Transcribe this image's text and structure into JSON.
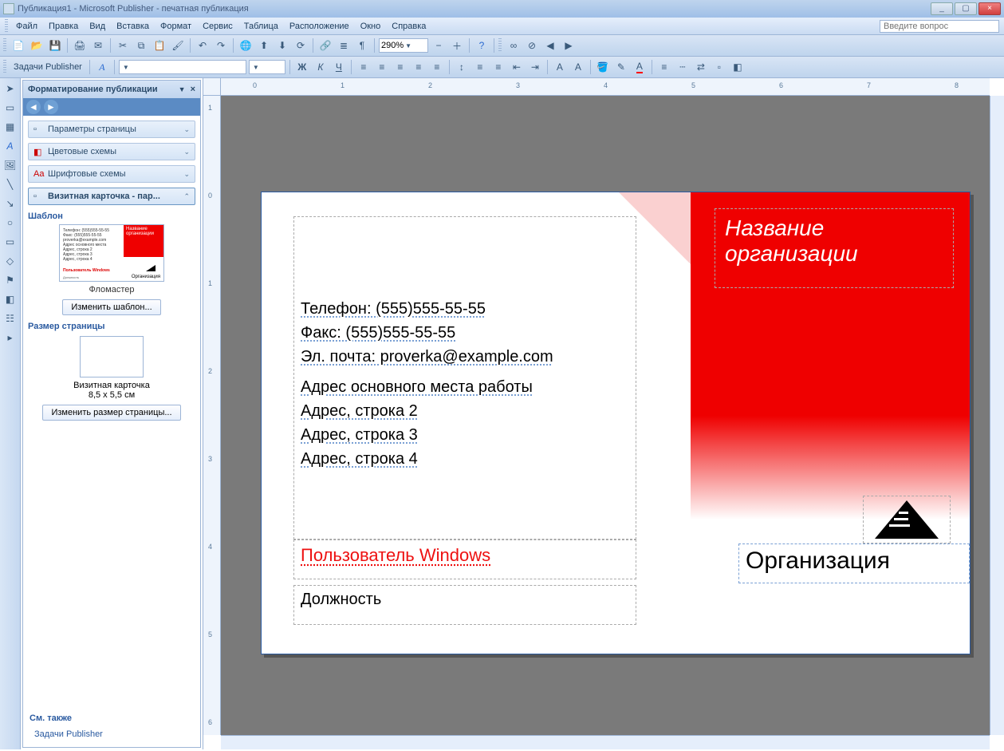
{
  "title": "Публикация1 - Microsoft Publisher - печатная публикация",
  "menu": {
    "file": "Файл",
    "edit": "Правка",
    "view": "Вид",
    "insert": "Вставка",
    "format": "Формат",
    "tools": "Сервис",
    "table": "Таблица",
    "arrange": "Расположение",
    "window": "Окно",
    "help": "Справка"
  },
  "askbox_placeholder": "Введите вопрос",
  "toolbar2_label": "Задачи Publisher",
  "zoom_value": "290%",
  "taskpane": {
    "title": "Форматирование публикации",
    "section_page": "Параметры страницы",
    "section_color": "Цветовые схемы",
    "section_font": "Шрифтовые схемы",
    "section_card": "Визитная карточка - пар...",
    "template_label": "Шаблон",
    "template_name": "Фломастер",
    "change_template_btn": "Изменить шаблон...",
    "size_label": "Размер страницы",
    "size_name": "Визитная карточка",
    "size_dims": "8,5 x 5,5 см",
    "change_size_btn": "Изменить размер страницы...",
    "see_also": "См. также",
    "tasks_link": "Задачи Publisher"
  },
  "card": {
    "orgname": "Название организации",
    "phone": "Телефон: (555)555-55-55",
    "fax": "Факс: (555)555-55-55",
    "email": "Эл. почта: proverka@example.com",
    "addr0": "Адрес основного места работы",
    "addr1": "Адрес, строка 2",
    "addr2": "Адрес, строка 3",
    "addr3": "Адрес, строка 4",
    "username": "Пользователь Windows",
    "role": "Должность",
    "orgcaption": "Организация"
  },
  "thumb": {
    "mini_orgname": "Название организации",
    "mini_org": "Организация",
    "mini_user": "Пользователь Windows"
  }
}
